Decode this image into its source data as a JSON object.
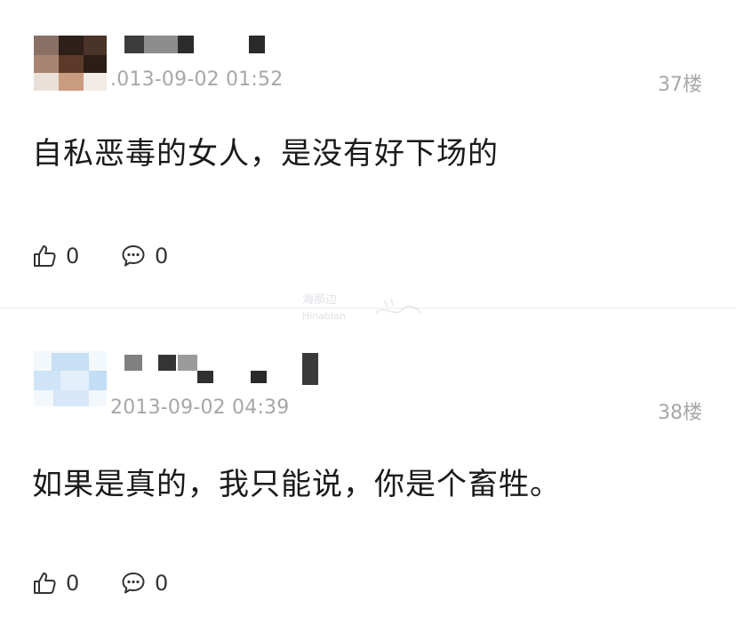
{
  "comments": [
    {
      "timestamp": ".013-09-02 01:52",
      "floor": "37楼",
      "text": "自私恶毒的女人，是没有好下场的",
      "likes": "0",
      "replies": "0",
      "avatar_colors": [
        "#3a2c24",
        "#7d5a45",
        "#b68d74",
        "#e5d6c8"
      ]
    },
    {
      "timestamp": "2013-09-02 04:39",
      "floor": "38楼",
      "text": "如果是真的，我只能说，你是个畜牲。",
      "likes": "0",
      "replies": "0",
      "avatar_colors": [
        "#b9d8f2",
        "#d7e9f8",
        "#eef6fd"
      ]
    }
  ],
  "watermark": {
    "line1": "海那边",
    "line2": "Hinabian"
  },
  "icons": {
    "like": "thumbs-up-icon",
    "reply": "comment-bubble-icon"
  },
  "colors": {
    "meta_text": "#a7a7a7",
    "content_text": "#1a1a1a",
    "divider": "#ececec"
  }
}
